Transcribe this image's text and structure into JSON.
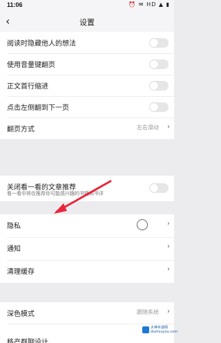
{
  "status_bar": {
    "time": "11:06",
    "right_icons": "⏰ ✉ HD ▲ ▮"
  },
  "nav": {
    "back_glyph": "‹",
    "title": "设置"
  },
  "groups": [
    {
      "rows": [
        {
          "label": "阅读时隐藏他人的想法",
          "control": "toggle",
          "on": false
        },
        {
          "label": "使用音量键翻页",
          "control": "toggle",
          "on": false
        },
        {
          "label": "正文首行缩进",
          "control": "toggle",
          "on": false
        },
        {
          "label": "点击左侧翻到下一页",
          "control": "toggle",
          "on": false
        },
        {
          "label": "翻页方式",
          "value": "左右滑动",
          "control": "chevron"
        }
      ]
    },
    {
      "rows": [
        {
          "label": "关闭看一看的文章推荐",
          "sub": "看一看中将仅推荐你可能感兴趣的书籍和书评",
          "control": "toggle",
          "on": false
        }
      ]
    },
    {
      "rows": [
        {
          "label": "隐私",
          "control": "chevron"
        },
        {
          "label": "通知",
          "control": "chevron"
        },
        {
          "label": "清理缓存",
          "control": "chevron"
        }
      ]
    },
    {
      "rows": [
        {
          "label": "深色模式",
          "value": "跟随系统",
          "control": "chevron"
        },
        {
          "label": "移产群聊设计",
          "control": "none"
        }
      ]
    }
  ],
  "chevron_glyph": "›",
  "watermark": {
    "line1": "大神手游网",
    "line2": "dsshouyou.com"
  },
  "colors": {
    "arrow": "#e8263c",
    "toggle_off": "#e6e6e6",
    "page_bg": "#ececee"
  }
}
